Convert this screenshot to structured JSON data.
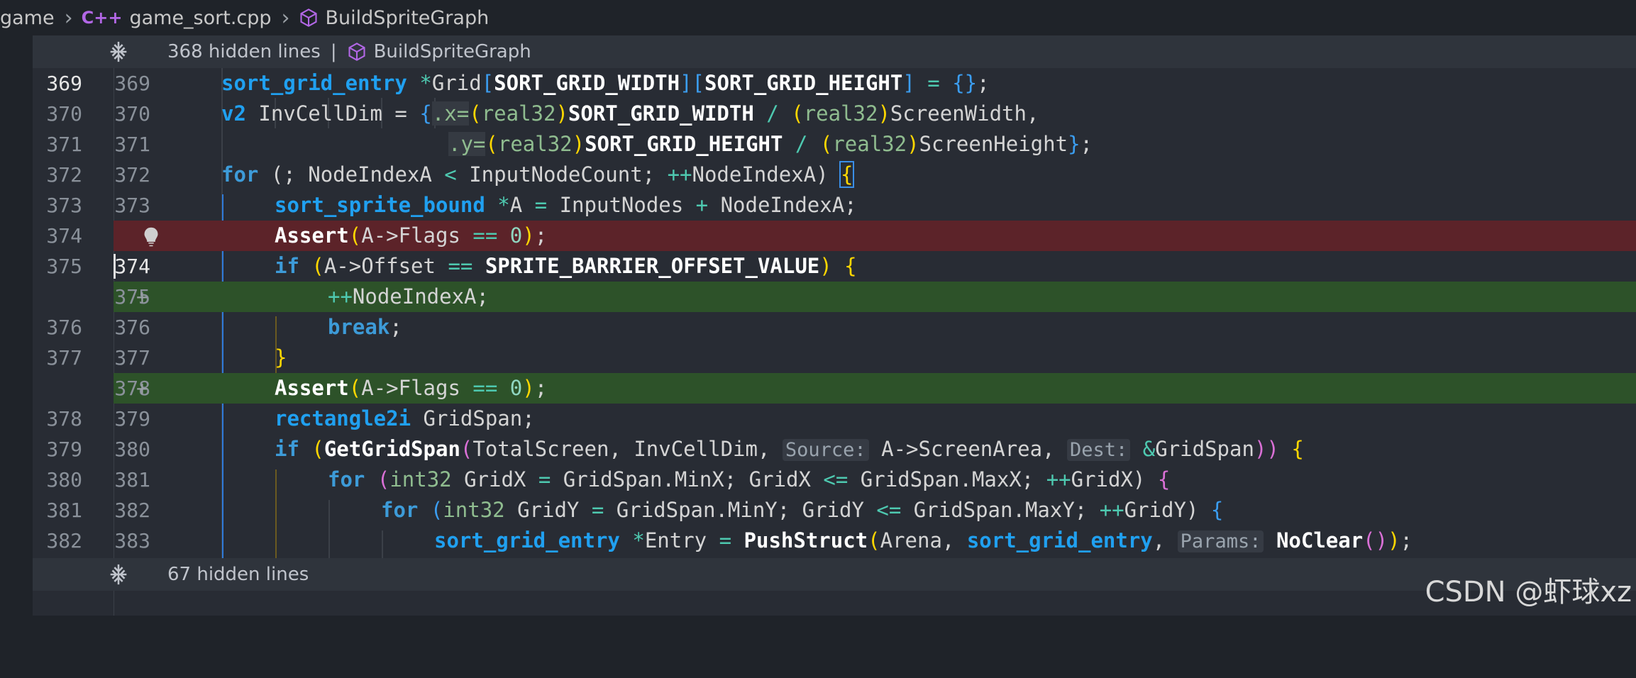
{
  "breadcrumb": {
    "folder": "game",
    "file_icon": "C++",
    "file": "game_sort.cpp",
    "symbol": "BuildSpriteGraph"
  },
  "folds": {
    "top_text": "368 hidden lines",
    "top_separator": "|",
    "top_symbol": "BuildSpriteGraph",
    "bottom_text": "67 hidden lines"
  },
  "lines": [
    {
      "old": "369",
      "new": "369"
    },
    {
      "old": "370",
      "new": "370"
    },
    {
      "old": "371",
      "new": "371"
    },
    {
      "old": "372",
      "new": "372"
    },
    {
      "old": "373",
      "new": "373"
    },
    {
      "old": "374",
      "new": ""
    },
    {
      "old": "375",
      "new": "374"
    },
    {
      "old": "",
      "new": "375",
      "marker": "+"
    },
    {
      "old": "376",
      "new": "376"
    },
    {
      "old": "377",
      "new": "377"
    },
    {
      "old": "",
      "new": "378",
      "marker": "+"
    },
    {
      "old": "378",
      "new": "379"
    },
    {
      "old": "379",
      "new": "380"
    },
    {
      "old": "380",
      "new": "381"
    },
    {
      "old": "381",
      "new": "382"
    },
    {
      "old": "382",
      "new": "383"
    }
  ],
  "code": {
    "l369": [
      "sort_grid_entry",
      " ",
      "*",
      "Grid",
      "[",
      "SORT_GRID_WIDTH",
      "][",
      "SORT_GRID_HEIGHT",
      "]",
      " = ",
      "{}",
      ";"
    ],
    "l370": [
      "v2",
      " InvCellDim = ",
      "{",
      ".x=",
      "(",
      "real32",
      ")",
      "SORT_GRID_WIDTH",
      " / ",
      "(",
      "real32",
      ")",
      "ScreenWidth,"
    ],
    "l371": [
      ".y=",
      "(",
      "real32",
      ")",
      "SORT_GRID_HEIGHT",
      " / ",
      "(",
      "real32",
      ")",
      "ScreenHeight",
      "}",
      ";"
    ],
    "l372": [
      "for",
      " (; NodeIndexA ",
      "<",
      " InputNodeCount; ",
      "++",
      "NodeIndexA) ",
      "{"
    ],
    "l373": [
      "sort_sprite_bound",
      " ",
      "*",
      "A ",
      "=",
      " InputNodes ",
      "+",
      " NodeIndexA;"
    ],
    "l374del": [
      "Assert",
      "(",
      "A->Flags ",
      "==",
      " ",
      "0",
      ")",
      ";"
    ],
    "l375": [
      "if",
      " (",
      "A->Offset ",
      "==",
      " ",
      "SPRITE_BARRIER_OFFSET_VALUE",
      ") ",
      "{"
    ],
    "l375add": [
      "++",
      "NodeIndexA;"
    ],
    "l376": [
      "break",
      ";"
    ],
    "l377": [
      "}"
    ],
    "l378add": [
      "Assert",
      "(",
      "A->Flags ",
      "==",
      " ",
      "0",
      ")",
      ";"
    ],
    "l379": [
      "rectangle2i",
      " GridSpan;"
    ],
    "l380": [
      "if",
      " (",
      "GetGridSpan",
      "(",
      "TotalScreen, InvCellDim, ",
      "Source:",
      " A->ScreenArea, ",
      "Dest:",
      " ",
      "&",
      "GridSpan",
      "))",
      " ",
      "{"
    ],
    "l381": [
      "for",
      " (",
      "int32",
      " GridX ",
      "=",
      " GridSpan.MinX; GridX ",
      "<=",
      " GridSpan.MaxX; ",
      "++",
      "GridX) ",
      "{"
    ],
    "l382": [
      "for",
      " (",
      "int32",
      " GridY ",
      "=",
      " GridSpan.MinY; GridY ",
      "<=",
      " GridSpan.MaxY; ",
      "++",
      "GridY) ",
      "{"
    ],
    "l383": [
      "sort_grid_entry",
      " ",
      "*",
      "Entry ",
      "=",
      " ",
      "PushStruct",
      "(",
      "Arena, ",
      "sort_grid_entry",
      ", ",
      "Params:",
      " ",
      "NoClear",
      "()",
      ")",
      ";"
    ]
  },
  "watermark": "CSDN @虾球xz",
  "colors": {
    "background": "#282c34",
    "deleted_line": "#5c2329",
    "added_line": "#2d5229",
    "keyword": "#3d9bd8"
  }
}
